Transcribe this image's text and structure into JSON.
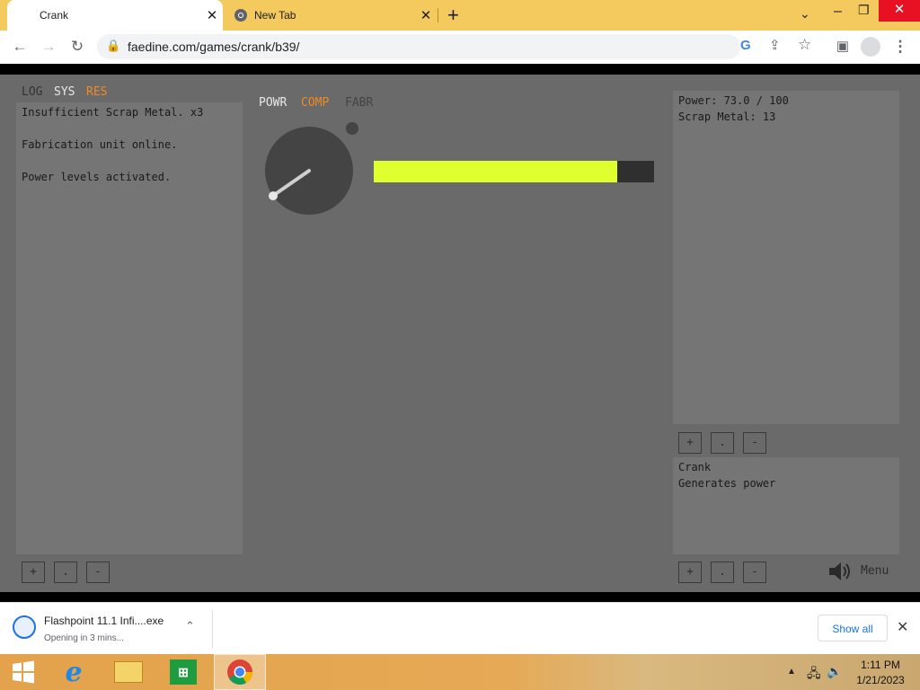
{
  "browser": {
    "tabs": [
      {
        "title": "Crank",
        "active": true
      },
      {
        "title": "New Tab",
        "active": false
      }
    ],
    "new_tab_symbol": "+",
    "url": "faedine.com/games/crank/b39/"
  },
  "game": {
    "left_tabs": {
      "log": "LOG",
      "sys": "SYS",
      "res": "RES",
      "active": "RES"
    },
    "log_lines": [
      "Insufficient Scrap Metal. x3",
      "Fabrication unit online.",
      "Power levels activated."
    ],
    "center_tabs": {
      "powr": "POWR",
      "comp": "COMP",
      "fabr": "FABR",
      "active": "COMP"
    },
    "crank_progress": 0.87,
    "stats": {
      "power": "Power: 73.0 / 100",
      "scrap": "Scrap Metal: 13"
    },
    "buttons": {
      "plus": "+",
      "dot": ".",
      "minus": "-"
    },
    "info": {
      "name": "Crank",
      "desc": "Generates power"
    },
    "menu_label": "Menu",
    "accent_color": "#f08a24",
    "bar_color": "#e0ff2f"
  },
  "downloads": {
    "file": "Flashpoint 11.1 Infi....exe",
    "status": "Opening in 3 mins...",
    "show_all": "Show all"
  },
  "taskbar": {
    "time": "1:11 PM",
    "date": "1/21/2023"
  }
}
